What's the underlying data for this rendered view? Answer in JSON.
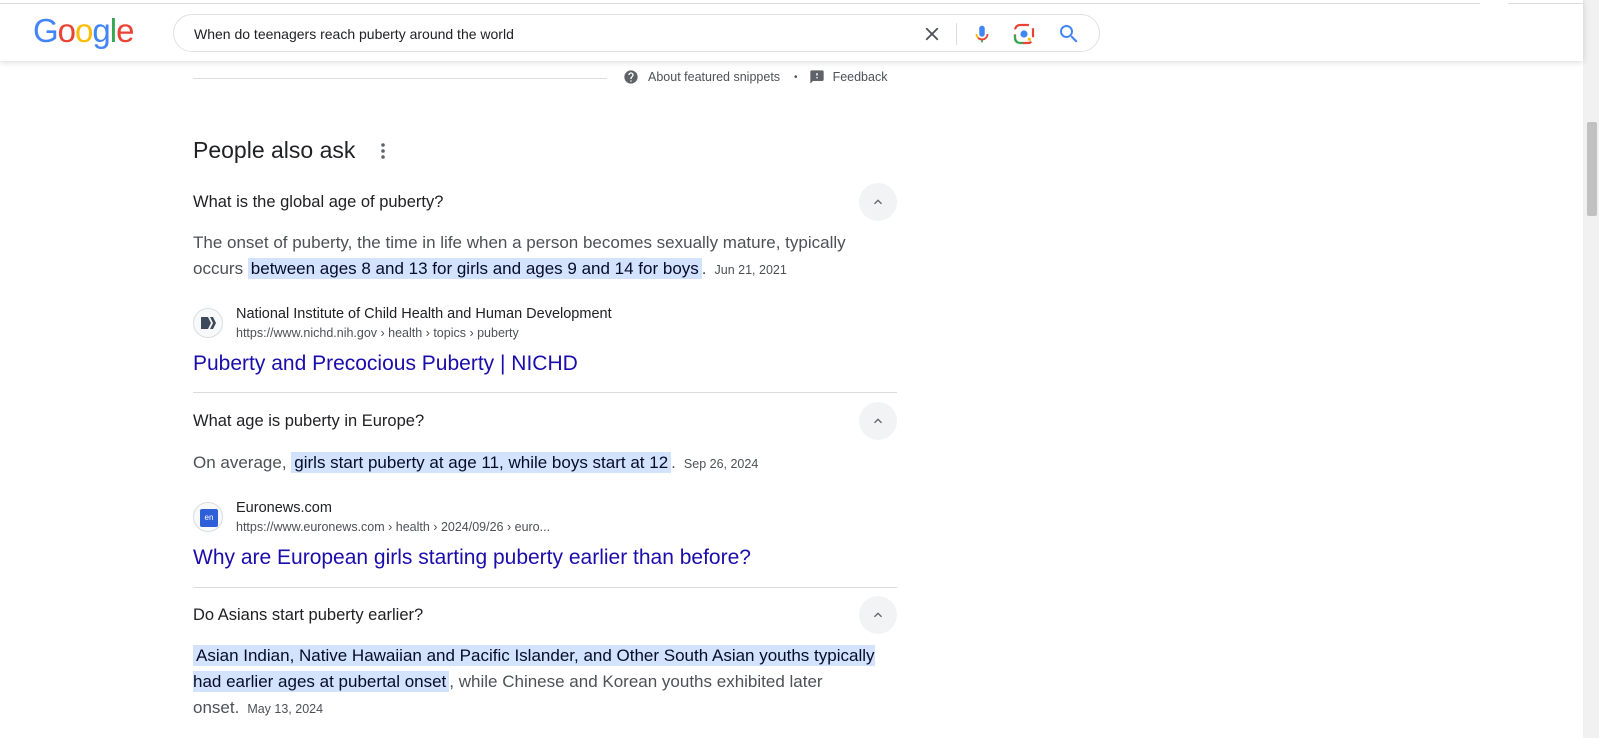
{
  "header": {
    "logo_text": "Google",
    "search_query": "When do teenagers reach puberty around the world"
  },
  "snippet_footer": {
    "about_label": "About featured snippets",
    "separator": "•",
    "feedback_label": "Feedback"
  },
  "paa": {
    "title": "People also ask",
    "items": [
      {
        "question": "What is the global age of puberty?",
        "answer_pre": "The onset of puberty, the time in life when a person becomes sexually mature, typically occurs ",
        "answer_highlight": "between ages 8 and 13 for girls and ages 9 and 14 for boys",
        "answer_post": ".",
        "date": "Jun 21, 2021",
        "source_name": "National Institute of Child Health and Human Development",
        "source_url": "https://www.nichd.nih.gov › health › topics › puberty",
        "link_title": "Puberty and Precocious Puberty | NICHD"
      },
      {
        "question": "What age is puberty in Europe?",
        "answer_pre": "On average, ",
        "answer_highlight": "girls start puberty at age 11, while boys start at 12",
        "answer_post": ".",
        "date": "Sep 26, 2024",
        "source_name": "Euronews.com",
        "source_url": "https://www.euronews.com › health › 2024/09/26 › euro...",
        "link_title": "Why are European girls starting puberty earlier than before?",
        "favicon_text": "en"
      },
      {
        "question": "Do Asians start puberty earlier?",
        "answer_highlight": "Asian Indian, Native Hawaiian and Pacific Islander, and Other South Asian youths typically had earlier ages at pubertal onset",
        "answer_post": ", while Chinese and Korean youths exhibited later onset.",
        "date": "May 13, 2024"
      }
    ]
  },
  "colors": {
    "link": "#1a0dab",
    "highlight": "#d3e3fd",
    "google_blue": "#4285f4",
    "google_red": "#ea4335",
    "google_yellow": "#fbbc05",
    "google_green": "#34a853"
  }
}
